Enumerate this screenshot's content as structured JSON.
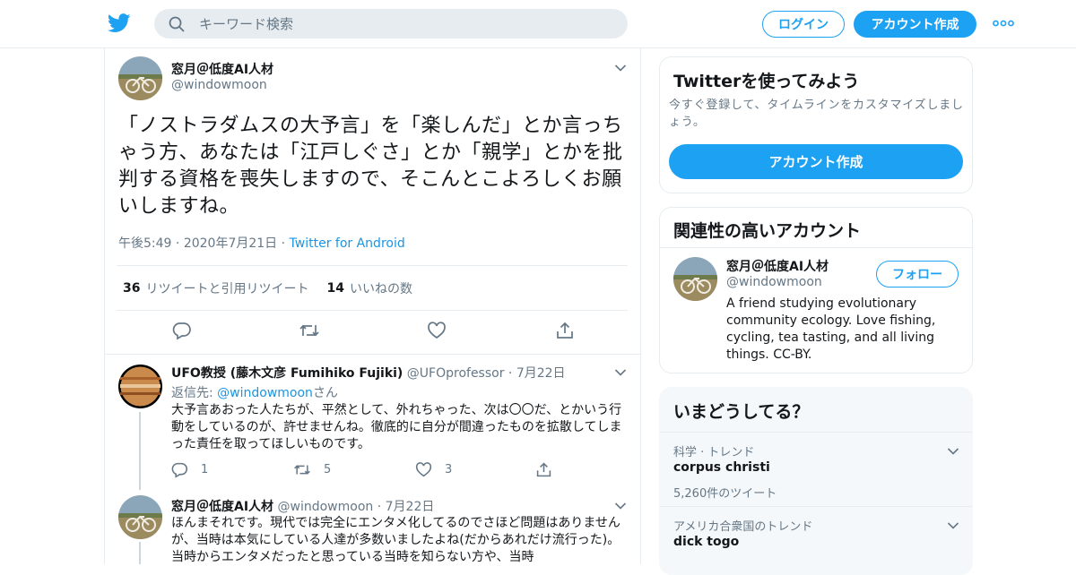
{
  "header": {
    "logo_icon": "twitter-bird-icon",
    "search_placeholder": "キーワード検索",
    "login_label": "ログイン",
    "signup_label": "アカウント作成",
    "brand_color": "#1da1f2"
  },
  "main_tweet": {
    "name": "窓月＠低度AI人材",
    "handle": "@windowmoon",
    "text": "「ノストラダムスの大予言」を「楽しんだ」とか言っちゃう方、あなたは「江戸しぐさ」とか「親学」とかを批判する資格を喪失しますので、そこんとこよろしくお願いしますね。",
    "time": "午後5:49",
    "date": "2020年7月21日",
    "source": "Twitter for Android",
    "retweets_count": "36",
    "retweets_label": "リツイートと引用リツイート",
    "likes_count": "14",
    "likes_label": "いいねの数"
  },
  "replies": [
    {
      "name": "UFO教授 (藤木文彦 Fumihiko Fujiki)",
      "handle": "@UFOprofessor",
      "date": "7月22日",
      "reply_to_prefix": "返信先: ",
      "reply_to_handle": "@windowmoon",
      "reply_to_suffix": "さん",
      "text": "大予言あおった人たちが、平然として、外れちゃった、次は〇〇だ、とかいう行動をしているのが、許せませんね。徹底的に自分が間違ったものを拡散してしまった責任を取ってほしいものです。",
      "reply_count": "1",
      "retweet_count": "5",
      "like_count": "3"
    },
    {
      "name": "窓月＠低度AI人材",
      "handle": "@windowmoon",
      "date": "7月22日",
      "text": "ほんまそれです。現代では完全にエンタメ化してるのでさほど問題はありませんが、当時は本気にしている人達が多数いましたよね(だからあれだけ流行った)。当時からエンタメだったと思っている当時を知らない方や、当時"
    }
  ],
  "sidebar": {
    "signup_card": {
      "title": "Twitterを使ってみよう",
      "desc": "今すぐ登録して、タイムラインをカスタマイズしましょう。",
      "button": "アカウント作成"
    },
    "related_card": {
      "title": "関連性の高いアカウント",
      "name": "窓月＠低度AI人材",
      "handle": "@windowmoon",
      "follow_label": "フォロー",
      "bio": "A friend studying evolutionary community ecology. Love fishing, cycling, tea tasting, and all living things. CC-BY."
    },
    "trends_card": {
      "title": "いまどうしてる？",
      "trends": [
        {
          "context": "科学 · トレンド",
          "name": "corpus christi",
          "count": "5,260件のツイート"
        },
        {
          "context": "アメリカ合衆国のトレンド",
          "name": "dick togo"
        }
      ]
    }
  }
}
